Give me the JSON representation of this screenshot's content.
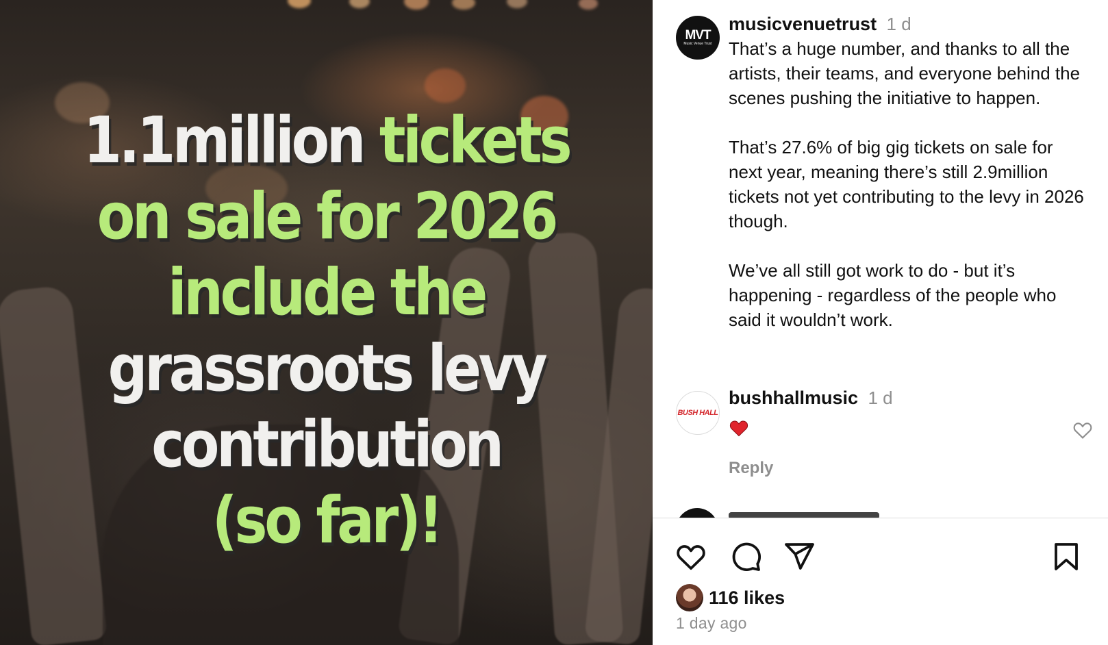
{
  "post_image": {
    "lines": [
      [
        {
          "text": "1.1million ",
          "color": "white"
        },
        {
          "text": "tickets",
          "color": "green"
        }
      ],
      [
        {
          "text": "on sale for 2026",
          "color": "green"
        }
      ],
      [
        {
          "text": "include the",
          "color": "green"
        }
      ],
      [
        {
          "text": "grassroots levy",
          "color": "white"
        }
      ],
      [
        {
          "text": "contribution",
          "color": "white"
        }
      ],
      [
        {
          "text": "(so far)!",
          "color": "green"
        }
      ]
    ],
    "colors": {
      "white": "#f1f0ee",
      "green": "#b7ea7b"
    }
  },
  "author": {
    "avatar_logo": "MVT",
    "avatar_logo_sub": "Music Venue Trust",
    "username": "musicvenuetrust",
    "time": "1 d"
  },
  "caption": {
    "text": "That’s a huge number, and thanks to all the artists, their teams, and everyone behind the scenes pushing the initiative to happen.\n\nThat’s 27.6% of big gig tickets on sale for next year, meaning there’s still 2.9million tickets not yet contributing to the levy in 2026 though.\n\nWe’ve all still got work to do - but it’s happening - regardless of the people who said it wouldn’t work."
  },
  "comments": [
    {
      "avatar_logo": "BUSH HALL",
      "username": "bushhallmusic",
      "time": "1 d",
      "emoji": "red-heart",
      "reply_label": "Reply"
    }
  ],
  "actions": {
    "icons": [
      "heart-icon",
      "comment-icon",
      "share-icon",
      "bookmark-icon"
    ]
  },
  "likes": {
    "count_label": "116 likes"
  },
  "timestamp": "1 day ago"
}
